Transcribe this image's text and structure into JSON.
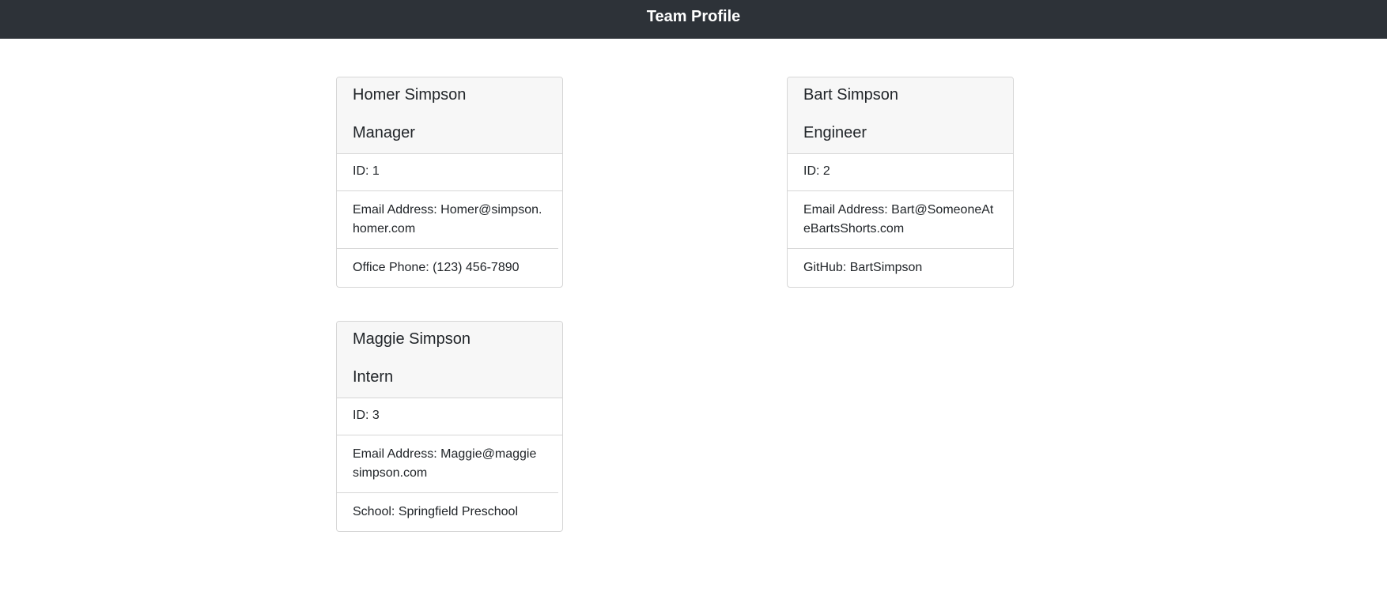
{
  "header": {
    "title": "Team Profile"
  },
  "cards": [
    {
      "name": "Homer Simpson",
      "role": "Manager",
      "id": "ID: 1",
      "email": "Email Address: Homer@simpson.homer.com",
      "extra": "Office Phone: (123) 456-7890"
    },
    {
      "name": "Bart Simpson",
      "role": "Engineer",
      "id": "ID: 2",
      "email": "Email Address: Bart@SomeoneAteBartsShorts.com",
      "extra": "GitHub: BartSimpson"
    },
    {
      "name": "Maggie Simpson",
      "role": "Intern",
      "id": "ID: 3",
      "email": "Email Address: Maggie@maggiesimpson.com",
      "extra": "School: Springfield Preschool"
    }
  ]
}
